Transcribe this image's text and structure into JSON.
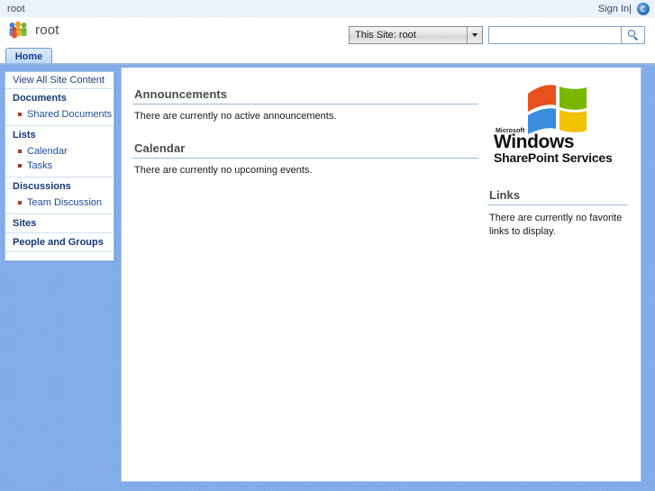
{
  "topbar": {
    "breadcrumb": "root",
    "sign_in_label": "Sign In|",
    "help_icon": "help-icon"
  },
  "header": {
    "site_title": "root",
    "site_icon": "sharepoint-people-icon"
  },
  "search": {
    "scope_value": "This Site: root",
    "scope_options": [
      "This Site: root"
    ],
    "input_value": "",
    "input_placeholder": "",
    "go_icon": "search-icon"
  },
  "tabs": [
    {
      "label": "Home",
      "selected": true
    }
  ],
  "sidebar": {
    "quick_link": "View All Site Content",
    "sections": [
      {
        "heading": "Documents",
        "items": [
          {
            "label": "Shared Documents"
          }
        ]
      },
      {
        "heading": "Lists",
        "items": [
          {
            "label": "Calendar"
          },
          {
            "label": "Tasks"
          }
        ]
      },
      {
        "heading": "Discussions",
        "items": [
          {
            "label": "Team Discussion"
          }
        ]
      },
      {
        "heading": "Sites",
        "items": []
      },
      {
        "heading": "People and Groups",
        "items": []
      }
    ]
  },
  "main": {
    "webparts": [
      {
        "title": "Announcements",
        "empty_text": "There are currently no active announcements."
      },
      {
        "title": "Calendar",
        "empty_text": "There are currently no upcoming events."
      }
    ]
  },
  "right_column": {
    "logo": {
      "microsoft": "Microsoft",
      "windows": "Windows",
      "product": "SharePoint Services",
      "flag_colors": {
        "top_left": "#e8501e",
        "top_right": "#7ab800",
        "bottom_left": "#3a8dde",
        "bottom_right": "#f2c200"
      }
    },
    "links": {
      "title": "Links",
      "empty_text": "There are currently no favorite links to display."
    }
  },
  "theme": {
    "page_background": "#7fa8e8",
    "panel_background": "#ffffff",
    "accent_border": "#9ec0e8",
    "heading_color": "#4a4a4a",
    "link_color": "#1d4d9e",
    "nav_heading_color": "#15387a",
    "bullet_color": "#a33a22"
  }
}
